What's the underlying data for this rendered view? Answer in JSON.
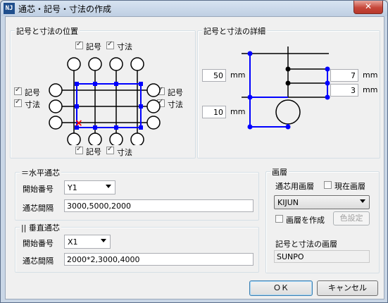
{
  "window": {
    "title": "通芯・記号・寸法の作成",
    "icon_text": "NJ",
    "close_label": "✕"
  },
  "position_group": {
    "title": "記号と寸法の位置",
    "top": {
      "symbol_label": "記号",
      "dim_label": "寸法",
      "symbol_checked": true,
      "dim_checked": true
    },
    "left": {
      "symbol_label": "記号",
      "dim_label": "寸法",
      "symbol_checked": true,
      "dim_checked": true
    },
    "right": {
      "symbol_label": "記号",
      "dim_label": "寸法",
      "symbol_checked": true,
      "dim_checked": true
    },
    "bottom": {
      "symbol_label": "記号",
      "dim_label": "寸法",
      "symbol_checked": true,
      "dim_checked": true
    }
  },
  "detail_group": {
    "title": "記号と寸法の詳細",
    "value_top_left": "50",
    "unit_top_left": "mm",
    "value_bottom_left": "10",
    "unit_bottom_left": "mm",
    "value_top_right": "7",
    "unit_top_right": "mm",
    "value_bottom_right": "3",
    "unit_bottom_right": "mm"
  },
  "horizontal_group": {
    "title": "＝水平通芯",
    "start_label": "開始番号",
    "start_value": "Y1",
    "interval_label": "通芯間隔",
    "interval_value": "3000,5000,2000"
  },
  "vertical_group": {
    "title": "|| 垂直通芯",
    "start_label": "開始番号",
    "start_value": "X1",
    "interval_label": "通芯間隔",
    "interval_value": "2000*2,3000,4000"
  },
  "layer_group": {
    "title": "画層",
    "grid_layer_label": "通芯用画層",
    "current_layer_label": "現在画層",
    "current_layer_checked": false,
    "layer_value": "KIJUN",
    "create_layer_label": "画層を作成",
    "create_layer_checked": false,
    "color_button_label": "色設定",
    "symdim_layer_label": "記号と寸法の画層",
    "symdim_layer_value": "SUNPO"
  },
  "buttons": {
    "ok_label": "ＯＫ",
    "cancel_label": "キャンセル"
  },
  "colors": {
    "accent": "#0000ff",
    "marker": "#ff0000"
  }
}
